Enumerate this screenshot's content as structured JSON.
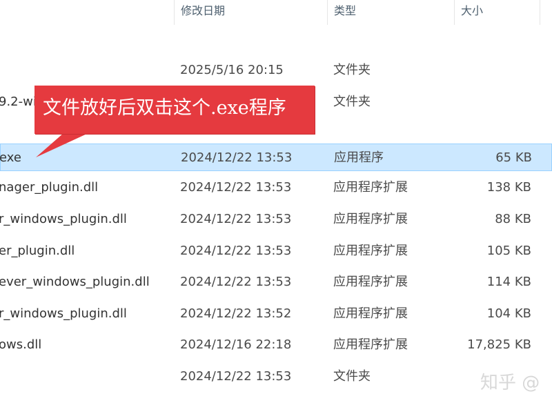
{
  "columns": {
    "date": "修改日期",
    "type": "类型",
    "size": "大小"
  },
  "rows": [
    {
      "name": "",
      "date": "2025/5/16 20:15",
      "type": "文件夹",
      "size": ""
    },
    {
      "name": "9.2-wi",
      "date": "",
      "type": "文件夹",
      "size": ""
    },
    {
      "name": "exe",
      "date": "2024/12/22 13:53",
      "type": "应用程序",
      "size": "65 KB"
    },
    {
      "name": "nager_plugin.dll",
      "date": "2024/12/22 13:53",
      "type": "应用程序扩展",
      "size": "138 KB"
    },
    {
      "name": "r_windows_plugin.dll",
      "date": "2024/12/22 13:53",
      "type": "应用程序扩展",
      "size": "88 KB"
    },
    {
      "name": "er_plugin.dll",
      "date": "2024/12/22 13:53",
      "type": "应用程序扩展",
      "size": "105 KB"
    },
    {
      "name": "ever_windows_plugin.dll",
      "date": "2024/12/22 13:53",
      "type": "应用程序扩展",
      "size": "114 KB"
    },
    {
      "name": "r_windows_plugin.dll",
      "date": "2024/12/22 13:52",
      "type": "应用程序扩展",
      "size": "104 KB"
    },
    {
      "name": "ows.dll",
      "date": "2024/12/16 22:18",
      "type": "应用程序扩展",
      "size": "17,825 KB"
    },
    {
      "name": "",
      "date": "2024/12/22 13:53",
      "type": "文件夹",
      "size": ""
    }
  ],
  "selected_row": 2,
  "callout": {
    "text": "文件放好后双击这个.exe程序",
    "color": "#e53a3f"
  },
  "watermark": "知乎 @"
}
